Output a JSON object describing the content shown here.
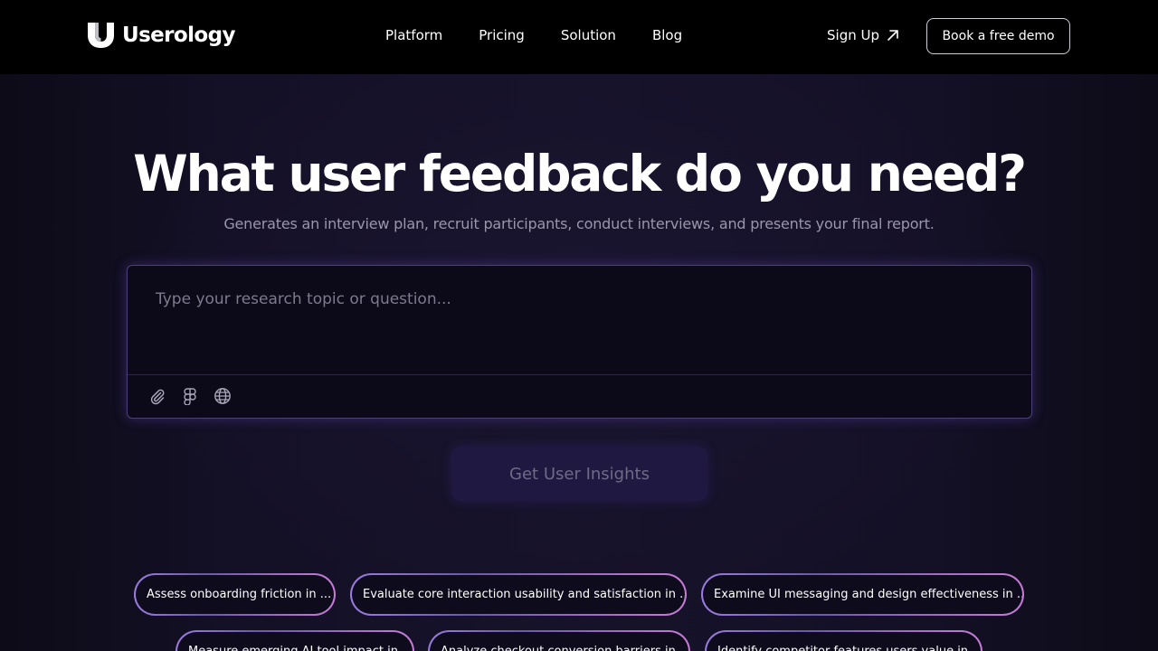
{
  "brand": {
    "name": "Userology"
  },
  "nav": {
    "links": [
      {
        "label": "Platform"
      },
      {
        "label": "Pricing"
      },
      {
        "label": "Solution"
      },
      {
        "label": "Blog"
      }
    ],
    "signup_label": "Sign Up",
    "demo_label": "Book a free demo"
  },
  "hero": {
    "title": "What user feedback do you need?",
    "subtitle": "Generates an interview plan, recruit participants, conduct interviews, and presents your final report."
  },
  "prompt": {
    "placeholder": "Type your research topic or question...",
    "value": "",
    "tools": [
      "paperclip-icon",
      "figma-icon",
      "globe-icon"
    ]
  },
  "cta": {
    "label": "Get User Insights"
  },
  "suggestions": [
    {
      "label": "Assess onboarding friction in ..."
    },
    {
      "label": "Evaluate core interaction usability and satisfaction in ..."
    },
    {
      "label": "Examine UI messaging and design effectiveness in ..."
    },
    {
      "label": "Measure emerging AI tool impact in ..."
    },
    {
      "label": "Analyze checkout conversion barriers in ..."
    },
    {
      "label": "Identify competitor features users value in ..."
    }
  ],
  "colors": {
    "background": "#0f0c1d",
    "nav_background": "#000000",
    "accent_gradient_start": "#9a7ce0",
    "accent_gradient_end": "#c77bd6",
    "cta_background": "#1f1840"
  }
}
